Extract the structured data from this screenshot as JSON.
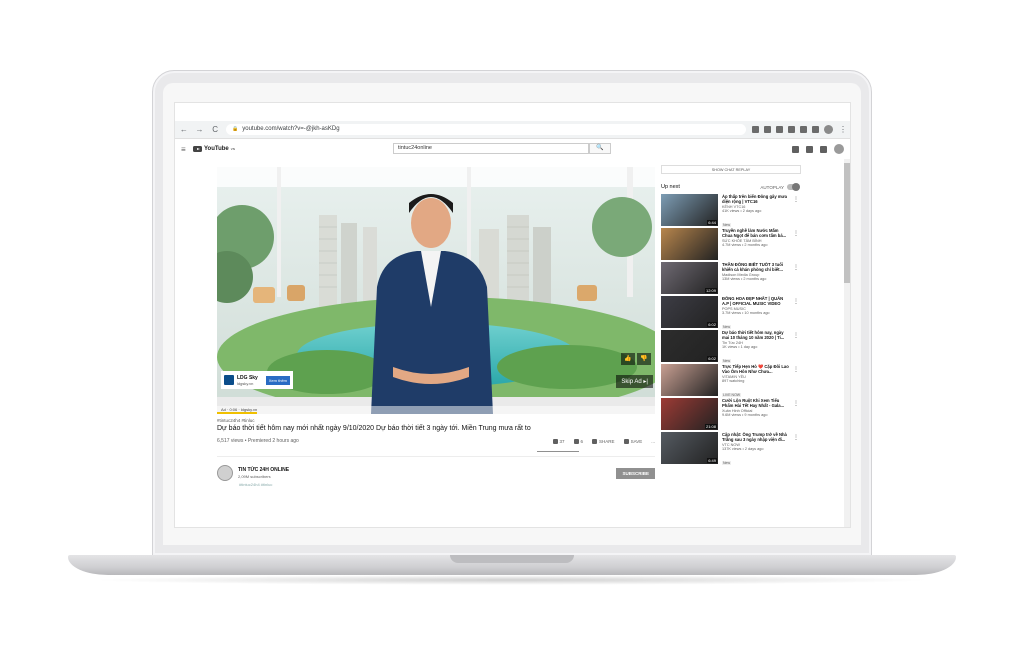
{
  "browser": {
    "url": "youtube.com/watch?v=-@jkh-asKDg",
    "back": "←",
    "forward": "→",
    "reload": "C"
  },
  "header": {
    "logo_text": "YouTube",
    "logo_region": "VN",
    "search_value": "tintuc24online",
    "search_icon": "🔍"
  },
  "video": {
    "ad": {
      "title": "LDG Sky",
      "url": "ldgsky.vn",
      "button": "Xem thêm",
      "footer": "Ad · 0:06 · ldgsky.vn"
    },
    "skip_label": "Skip Ad ▸|",
    "hashtags": "#tintuc24h4 #tinluc",
    "title": "Dự báo thời tiết hôm nay mới nhất ngày 9/10/2020 Dự báo thời tiết 3 ngày tới. Miền Trung mưa rất to",
    "views": "6,517 views • Premiered 2 hours ago",
    "actions": {
      "likes": "37",
      "dislikes": "6",
      "share": "SHARE",
      "save": "SAVE",
      "more": "..."
    }
  },
  "channel": {
    "name": "TIN TỨC 24H ONLINE",
    "subscribers": "2,09M subscribers",
    "subscribe_label": "SUBSCRIBE",
    "tags": "#tintuc24h4 #tinluc"
  },
  "sidebar": {
    "chat_replay": "SHOW CHAT REPLAY",
    "up_next": "Up next",
    "autoplay": "AUTOPLAY",
    "items": [
      {
        "title": "Áp thấp trên biển Đông gây mưa diện rộng | VTC16",
        "channel": "KÊNH VTC16",
        "meta": "41K views • 2 days ago",
        "badge": "New",
        "duration": "6:44",
        "color": "#7d9db5"
      },
      {
        "title": "Truyền nghề làm Nước Mắm Chua Ngọt để bán cơm tấm bá...",
        "channel": "SỨC KHỎE TÂM BÌNH",
        "meta": "4.7M views • 2 months ago",
        "badge": "",
        "duration": "",
        "color": "#b8864d"
      },
      {
        "title": "THẦN ĐỒNG BIẾT TUỐT 3 tuổi khiến cả khán phòng chỉ biết...",
        "channel": "Madison Media Group",
        "meta": "13M views • 2 months ago",
        "badge": "",
        "duration": "12:09",
        "color": "#6f6a73"
      },
      {
        "title": "ĐÔNG HOA ĐẸP NHẤT | QUÂN A.P | OFFICIAL MUSIC VIDEO",
        "channel": "POPS MUSIC",
        "meta": "3.7M views • 10 months ago",
        "badge": "New",
        "duration": "6:02",
        "color": "#3d3d45"
      },
      {
        "title": "Dự báo thời tiết hôm nay, ngày mai 10 tháng 10 năm 2020 | Ti...",
        "channel": "Tin Tức 24H",
        "meta": "1K views • 1 day ago",
        "badge": "New",
        "duration": "6:02",
        "color": "#2d2d2d"
      },
      {
        "title": "Trực Tiếp Hẹn Hò ❤️ Cặp Đôi Lao Vào Ôm Hôn Như Chưa...",
        "channel": "VITAMIN YÊU",
        "meta": "897 watching",
        "badge": "LIVE NOW",
        "duration": "",
        "color": "#c9a093"
      },
      {
        "title": "Cười Lộn Ruột Khi Xem Tiểu Phẩm Hài Tết Hay Nhất - Gala...",
        "channel": "Xuân Hinh Official",
        "meta": "9.6M views • 9 months ago",
        "badge": "",
        "duration": "21:08",
        "color": "#9d3b35"
      },
      {
        "title": "Cập nhật: Ông Trump trở về Nhà Trắng sau 3 ngày nhập viện đi...",
        "channel": "VTC NOW",
        "meta": "137K views • 2 days ago",
        "badge": "New",
        "duration": "6:49",
        "color": "#555b62"
      }
    ]
  }
}
